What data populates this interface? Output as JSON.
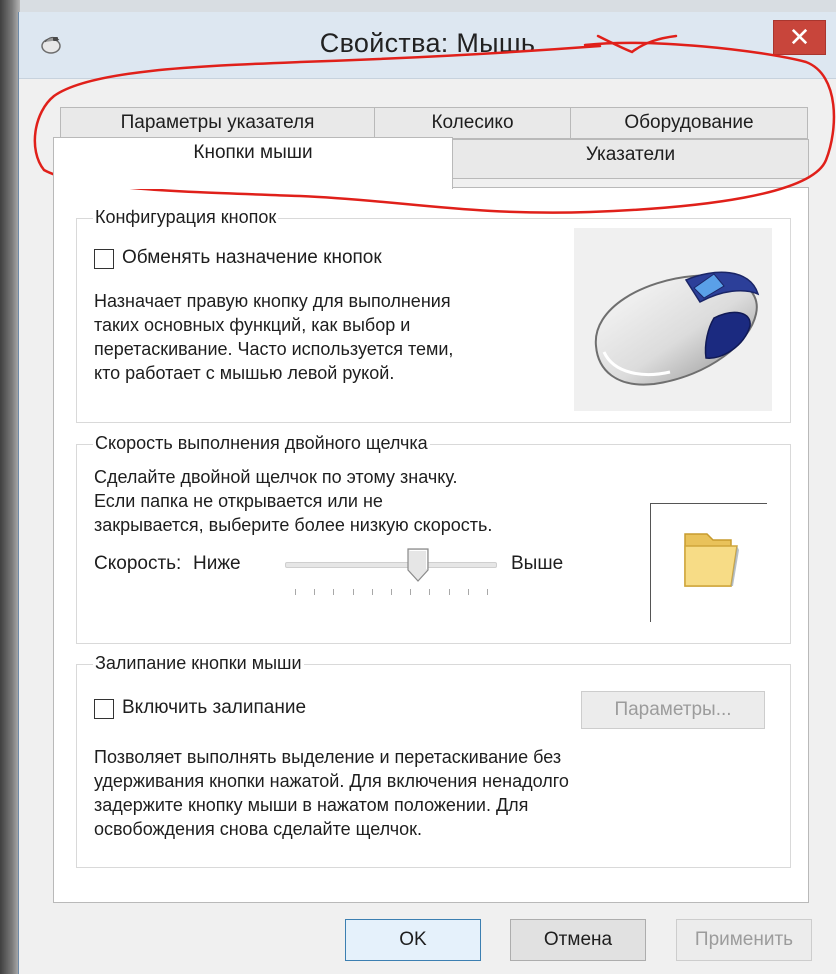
{
  "window": {
    "title": "Свойства: Мышь",
    "close_symbol": "✕"
  },
  "tabs": {
    "back_row": [
      {
        "label": "Параметры указателя"
      },
      {
        "label": "Колесико"
      },
      {
        "label": "Оборудование"
      }
    ],
    "front_row": [
      {
        "label": "Кнопки мыши",
        "active": true
      },
      {
        "label": "Указатели",
        "active": false
      }
    ]
  },
  "button_config": {
    "title": "Конфигурация кнопок",
    "swap_checkbox_label": "Обменять назначение кнопок",
    "swap_checked": false,
    "description_lines": [
      "Назначает правую кнопку для выполнения",
      "таких основных функций, как выбор и",
      "перетаскивание. Часто используется теми,",
      "кто работает с мышью левой рукой."
    ],
    "image_icon": "mouse-icon"
  },
  "double_click": {
    "title": "Скорость выполнения двойного щелчка",
    "description_lines": [
      "Сделайте двойной щелчок по этому значку.",
      "Если папка не открывается или не",
      "закрывается, выберите более низкую скорость."
    ],
    "speed_label": "Скорость:",
    "low_label": "Ниже",
    "high_label": "Выше",
    "slider_fraction": 0.64,
    "test_icon": "folder-icon"
  },
  "click_lock": {
    "title": "Залипание кнопки мыши",
    "checkbox_label": "Включить залипание",
    "checked": false,
    "settings_button": "Параметры...",
    "description_lines": [
      "Позволяет выполнять выделение и перетаскивание без",
      "удерживания кнопки нажатой. Для включения ненадолго",
      "задержите кнопку мыши в нажатом положении. Для",
      "освобождения снова сделайте щелчок."
    ]
  },
  "footer": {
    "ok": "OK",
    "cancel": "Отмена",
    "apply": "Применить"
  },
  "colors": {
    "annotation": "#e0201a",
    "close_button": "#c8453b",
    "titlebar": "#dde7f1"
  }
}
